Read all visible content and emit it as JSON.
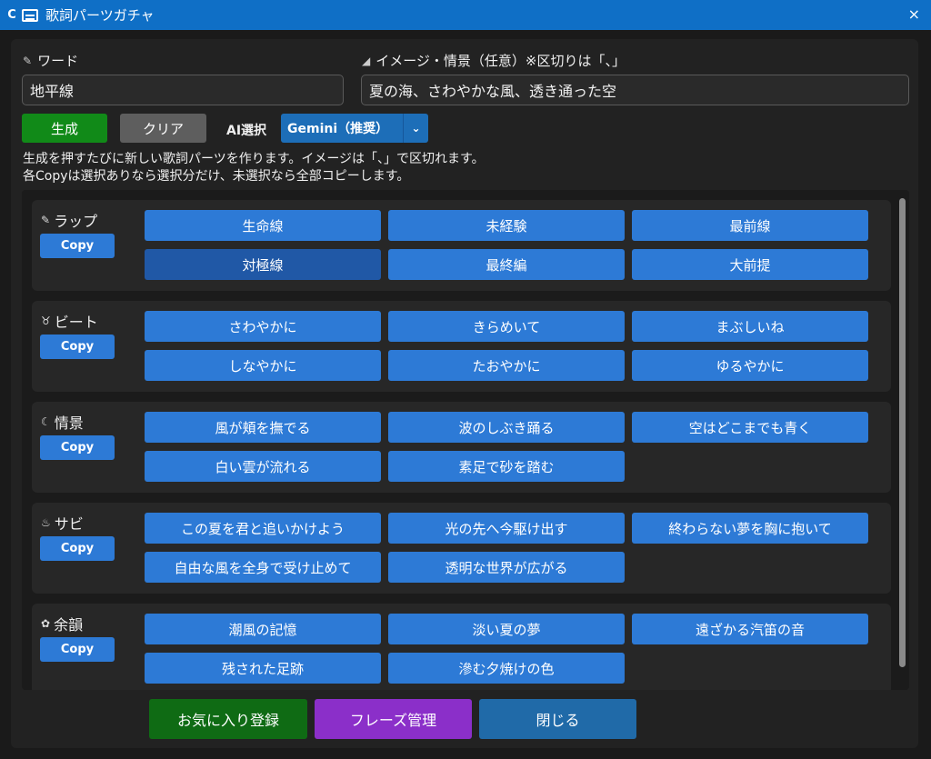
{
  "window": {
    "title": "歌詞パーツガチャ",
    "close": "×",
    "app_glyph": "C"
  },
  "word": {
    "label": "ワード",
    "value": "地平線",
    "icon": "microphone-icon"
  },
  "image": {
    "label": "イメージ・情景（任意）※区切りは「、」",
    "value": "夏の海、さわやかな風、透き通った空",
    "icon": "wave-icon"
  },
  "actions": {
    "generate": "生成",
    "clear": "クリア",
    "ai_label": "AI選択",
    "ai_value": "Gemini（推奨）",
    "ai_arrow": "⌄"
  },
  "help": [
    "生成を押すたびに新しい歌詞パーツを作ります。イメージは「、」で区切れます。",
    "各Copyは選択ありなら選択分だけ、未選択なら全部コピーします。"
  ],
  "copy_label": "Copy",
  "sections": [
    {
      "title": "ラップ",
      "icon": "✎",
      "chips": [
        "生命線",
        "未経験",
        "最前線",
        "対極線",
        "最終編",
        "大前提"
      ]
    },
    {
      "title": "ビート",
      "icon": "♉",
      "chips": [
        "さわやかに",
        "きらめいて",
        "まぶしいね",
        "しなやかに",
        "たおやかに",
        "ゆるやかに"
      ]
    },
    {
      "title": "情景",
      "icon": "☾",
      "chips": [
        "風が頬を撫でる",
        "波のしぶき踊る",
        "空はどこまでも青く",
        "白い雲が流れる",
        "素足で砂を踏む"
      ]
    },
    {
      "title": "サビ",
      "icon": "♨",
      "chips": [
        "この夏を君と追いかけよう",
        "光の先へ今駆け出す",
        "終わらない夢を胸に抱いて",
        "自由な風を全身で受け止めて",
        "透明な世界が広がる"
      ]
    },
    {
      "title": "余韻",
      "icon": "✿",
      "chips": [
        "潮風の記憶",
        "淡い夏の夢",
        "遠ざかる汽笛の音",
        "残された足跡",
        "滲む夕焼けの色"
      ]
    }
  ],
  "footer": {
    "favorite": "お気に入り登録",
    "phrases": "フレーズ管理",
    "close": "閉じる"
  }
}
